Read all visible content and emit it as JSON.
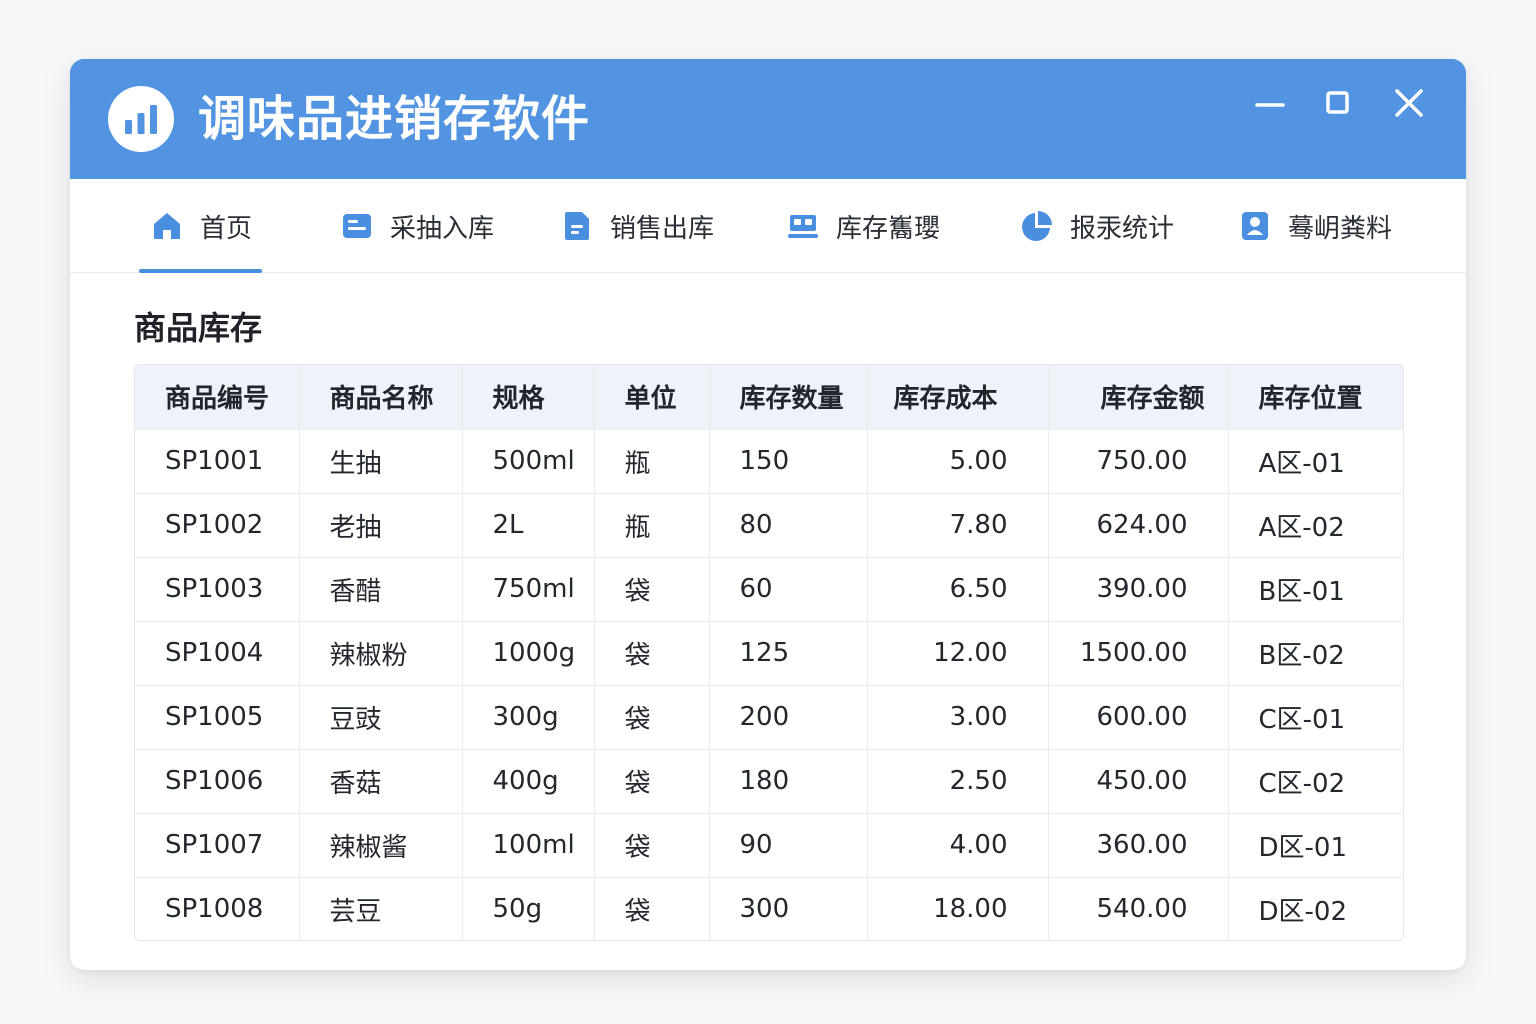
{
  "window": {
    "title": "调味品进销存软件",
    "icon": "bar-chart-icon",
    "controls": [
      "minimize-icon",
      "maximize-icon",
      "close-icon"
    ]
  },
  "colors": {
    "titlebar": "#5294e2",
    "accent": "#4a8ee0",
    "header_bg": "#eef3f9"
  },
  "nav": {
    "items": [
      {
        "label": "首页",
        "icon": "home-icon",
        "active": true
      },
      {
        "label": "采抽入库",
        "icon": "inbound-icon",
        "active": false
      },
      {
        "label": "销售出库",
        "icon": "outbound-icon",
        "active": false
      },
      {
        "label": "库存雟瓔",
        "icon": "inventory-icon",
        "active": false
      },
      {
        "label": "报汞统计",
        "icon": "pie-chart-icon",
        "active": false
      },
      {
        "label": "蓦岄粪料",
        "icon": "user-card-icon",
        "active": false
      }
    ]
  },
  "main": {
    "section_title": "商品库存",
    "table": {
      "columns": [
        "商品编号",
        "商品名称",
        "规格",
        "单位",
        "库存数量",
        "库存成本",
        "库存金额",
        "库存位置"
      ],
      "rows": [
        [
          "SP1001",
          "生抽",
          "500ml",
          "瓶",
          "150",
          "5.00",
          "750.00",
          "A区-01"
        ],
        [
          "SP1002",
          "老抽",
          "2L",
          "瓶",
          "80",
          "7.80",
          "624.00",
          "A区-02"
        ],
        [
          "SP1003",
          "香醋",
          "750ml",
          "袋",
          "60",
          "6.50",
          "390.00",
          "B区-01"
        ],
        [
          "SP1004",
          "辣椒粉",
          "1000g",
          "袋",
          "125",
          "12.00",
          "1500.00",
          "B区-02"
        ],
        [
          "SP1005",
          "豆豉",
          "300g",
          "袋",
          "200",
          "3.00",
          "600.00",
          "C区-01"
        ],
        [
          "SP1006",
          "香菇",
          "400g",
          "袋",
          "180",
          "2.50",
          "450.00",
          "C区-02"
        ],
        [
          "SP1007",
          "辣椒酱",
          "100ml",
          "袋",
          "90",
          "4.00",
          "360.00",
          "D区-01"
        ],
        [
          "SP1008",
          "芸豆",
          "50g",
          "袋",
          "300",
          "18.00",
          "540.00",
          "D区-02"
        ]
      ]
    }
  }
}
